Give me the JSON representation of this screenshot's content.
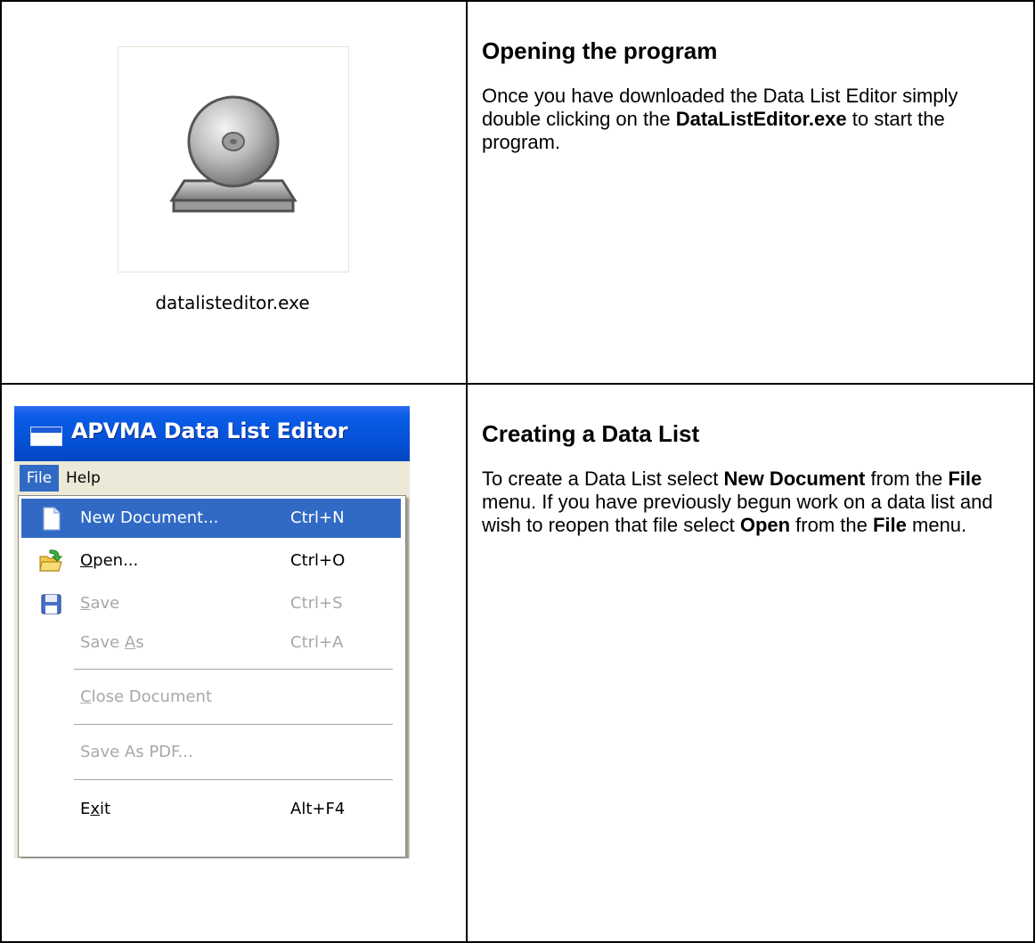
{
  "rows": [
    {
      "icon": {
        "name": "application-cd-icon",
        "caption": "datalisteditor.exe"
      },
      "title": "Opening the program",
      "body": {
        "part1": "Once you have downloaded the Data List Editor simply double clicking on the ",
        "bold1": "DataListEditor.exe",
        "part2": " to start the program."
      }
    },
    {
      "window": {
        "title": "APVMA Data List Editor",
        "menubar": {
          "file": "File",
          "help": "Help"
        },
        "menu_items": [
          {
            "label": "New Document...",
            "shortcut": "Ctrl+N",
            "state": "highlighted",
            "icon": "new-document-icon"
          },
          {
            "label": "Open...",
            "shortcut": "Ctrl+O",
            "state": "enabled",
            "icon": "open-folder-icon"
          },
          {
            "label": "Save",
            "shortcut": "Ctrl+S",
            "state": "disabled",
            "icon": "floppy-disk-icon"
          },
          {
            "label": "Save As",
            "shortcut": "Ctrl+A",
            "state": "disabled"
          },
          {
            "label": "Close Document",
            "shortcut": "",
            "state": "disabled"
          },
          {
            "label": "Save As PDF...",
            "shortcut": "",
            "state": "disabled"
          },
          {
            "label": "Exit",
            "shortcut": "Alt+F4",
            "state": "enabled"
          }
        ]
      },
      "title": "Creating a Data List",
      "body": {
        "part1": "To create a Data List select ",
        "bold1": "New Document",
        "part2": " from the ",
        "bold2": "File",
        "part3": " menu. If you have previously begun work on a data list and wish to reopen that file select ",
        "bold3": "Open",
        "part4": " from the ",
        "bold4": "File",
        "part5": " menu."
      }
    }
  ],
  "colors": {
    "xp_title_blue": "#0552d9",
    "menu_highlight": "#316ac5",
    "menu_bg": "#ece9d8",
    "disabled_text": "#a8a8a8"
  }
}
